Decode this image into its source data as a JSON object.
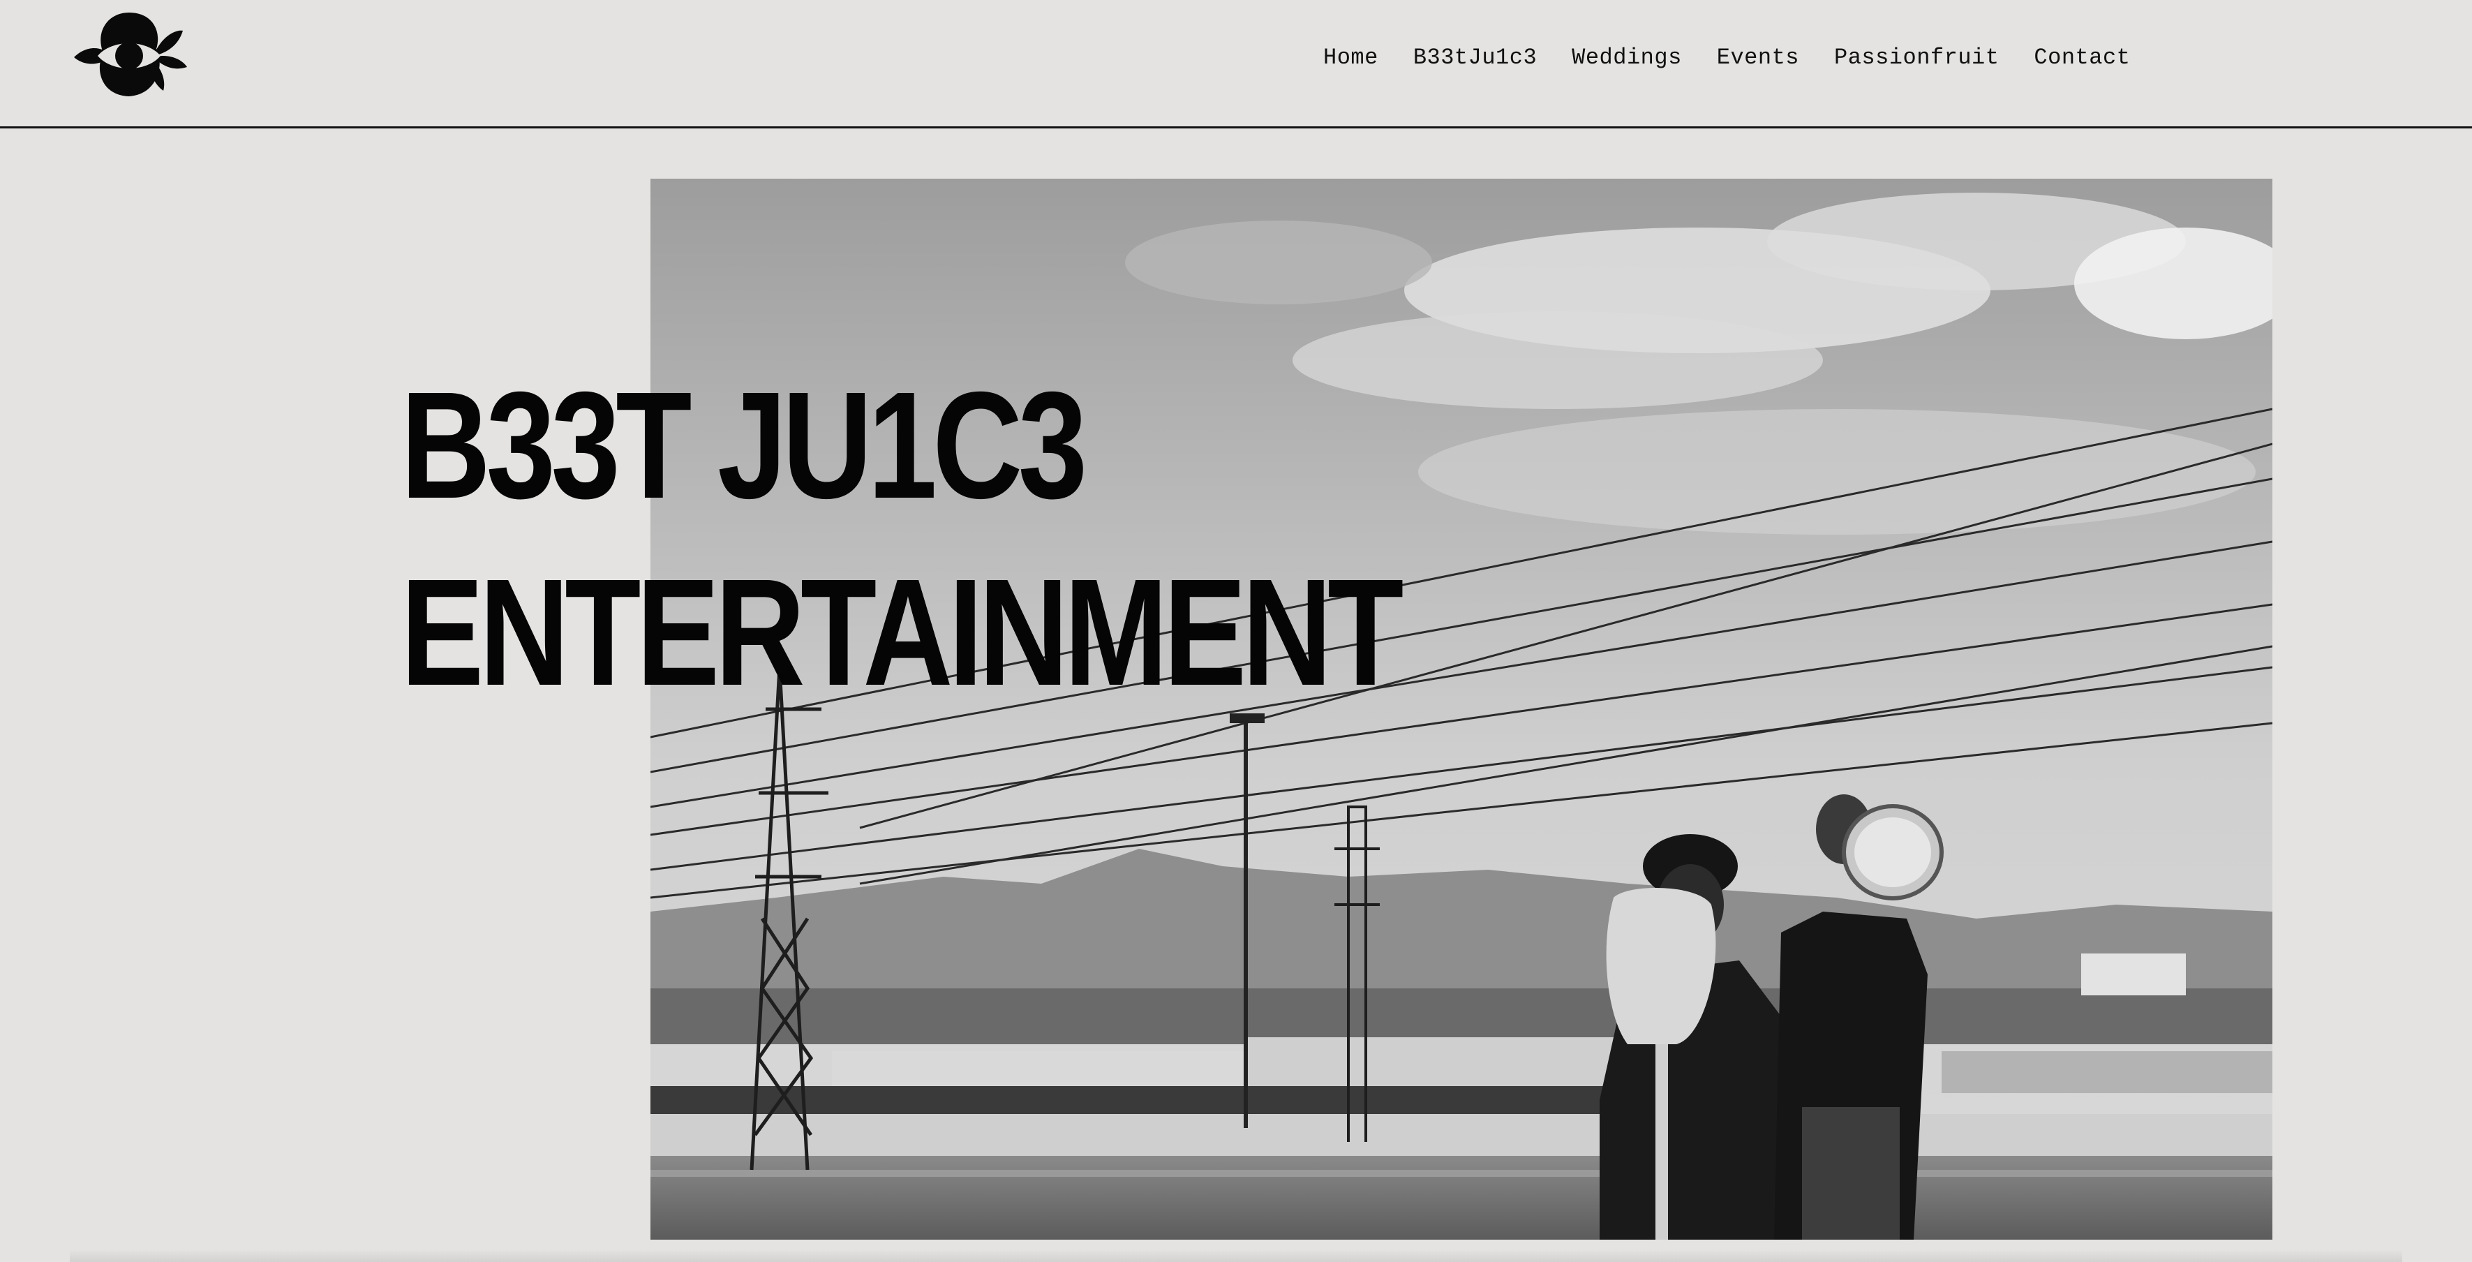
{
  "logo": {
    "icon": "eye-with-leaves-logo"
  },
  "nav": {
    "items": [
      {
        "label": "Home"
      },
      {
        "label": "B33tJu1c3"
      },
      {
        "label": "Weddings"
      },
      {
        "label": "Events"
      },
      {
        "label": "Passionfruit"
      },
      {
        "label": "Contact"
      }
    ]
  },
  "hero": {
    "title_line1": "B33T JU1C3",
    "title_line2": "ENTERTAINMENT",
    "image": "black-and-white-photo-two-musicians-with-guitar-and-tambourine-on-bridge-with-power-lines"
  },
  "colors": {
    "background": "#e4e3e1",
    "text": "#050505",
    "divider": "#111111"
  }
}
